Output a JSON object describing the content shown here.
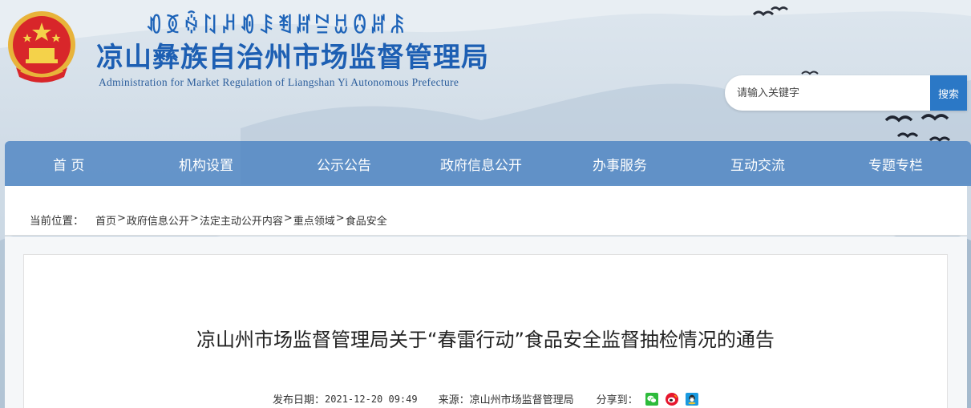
{
  "header": {
    "yi_script": "ꀒꅉꍇꇁꈚꀑꄩꄮꏦꊂꀠꐋꏦꄯ",
    "title": "凉山彝族自治州市场监督管理局",
    "subtitle": "Administration for Market Regulation of Liangshan Yi Autonomous Prefecture"
  },
  "search": {
    "placeholder": "请输入关键字",
    "button_label": "搜索"
  },
  "nav": {
    "items": [
      {
        "label": "首 页"
      },
      {
        "label": "机构设置"
      },
      {
        "label": "公示公告"
      },
      {
        "label": "政府信息公开"
      },
      {
        "label": "办事服务"
      },
      {
        "label": "互动交流"
      },
      {
        "label": "专题专栏"
      }
    ]
  },
  "breadcrumb": {
    "label": "当前位置：",
    "items": [
      "首页",
      "政府信息公开",
      "法定主动公开内容",
      "重点领域",
      "食品安全"
    ],
    "separator": ">"
  },
  "article": {
    "title": "凉山州市场监督管理局关于“春雷行动”食品安全监督抽检情况的通告",
    "date_label": "发布日期：",
    "date": "2021-12-20 09:49",
    "source_label": "来源：",
    "source": "凉山州市场监督管理局",
    "share_label": "分享到：",
    "share_icons": [
      "wechat-icon",
      "weibo-icon",
      "qq-icon"
    ]
  },
  "colors": {
    "brand_blue": "#1d5fb3",
    "nav_blue": "#3c78be",
    "search_button": "#2b78c6"
  }
}
